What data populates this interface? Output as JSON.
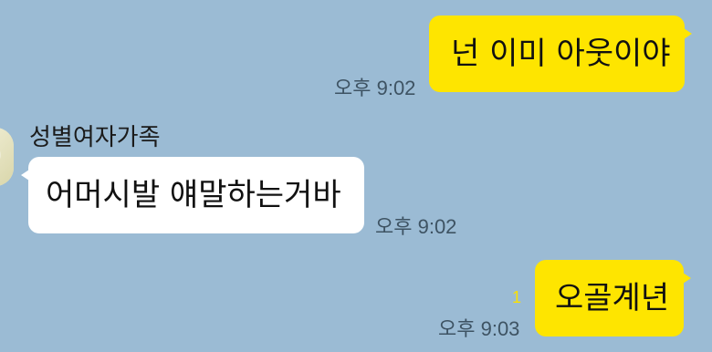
{
  "chat": {
    "messages": [
      {
        "direction": "outgoing",
        "text": "넌 이미 아웃이야",
        "time": "오후 9:02"
      },
      {
        "direction": "incoming",
        "sender": "성별여자가족",
        "text": "어머시발 얘말하는거바",
        "time": "오후 9:02"
      },
      {
        "direction": "outgoing",
        "text": "오골계년",
        "time": "오후 9:03",
        "unread_count": "1"
      }
    ]
  },
  "colors": {
    "background": "#9bbbd4",
    "outgoing_bubble": "#fee500",
    "incoming_bubble": "#ffffff",
    "time_text": "#3e5363",
    "unread_text": "#fbe100"
  },
  "icons": {
    "avatar": "avatar"
  }
}
